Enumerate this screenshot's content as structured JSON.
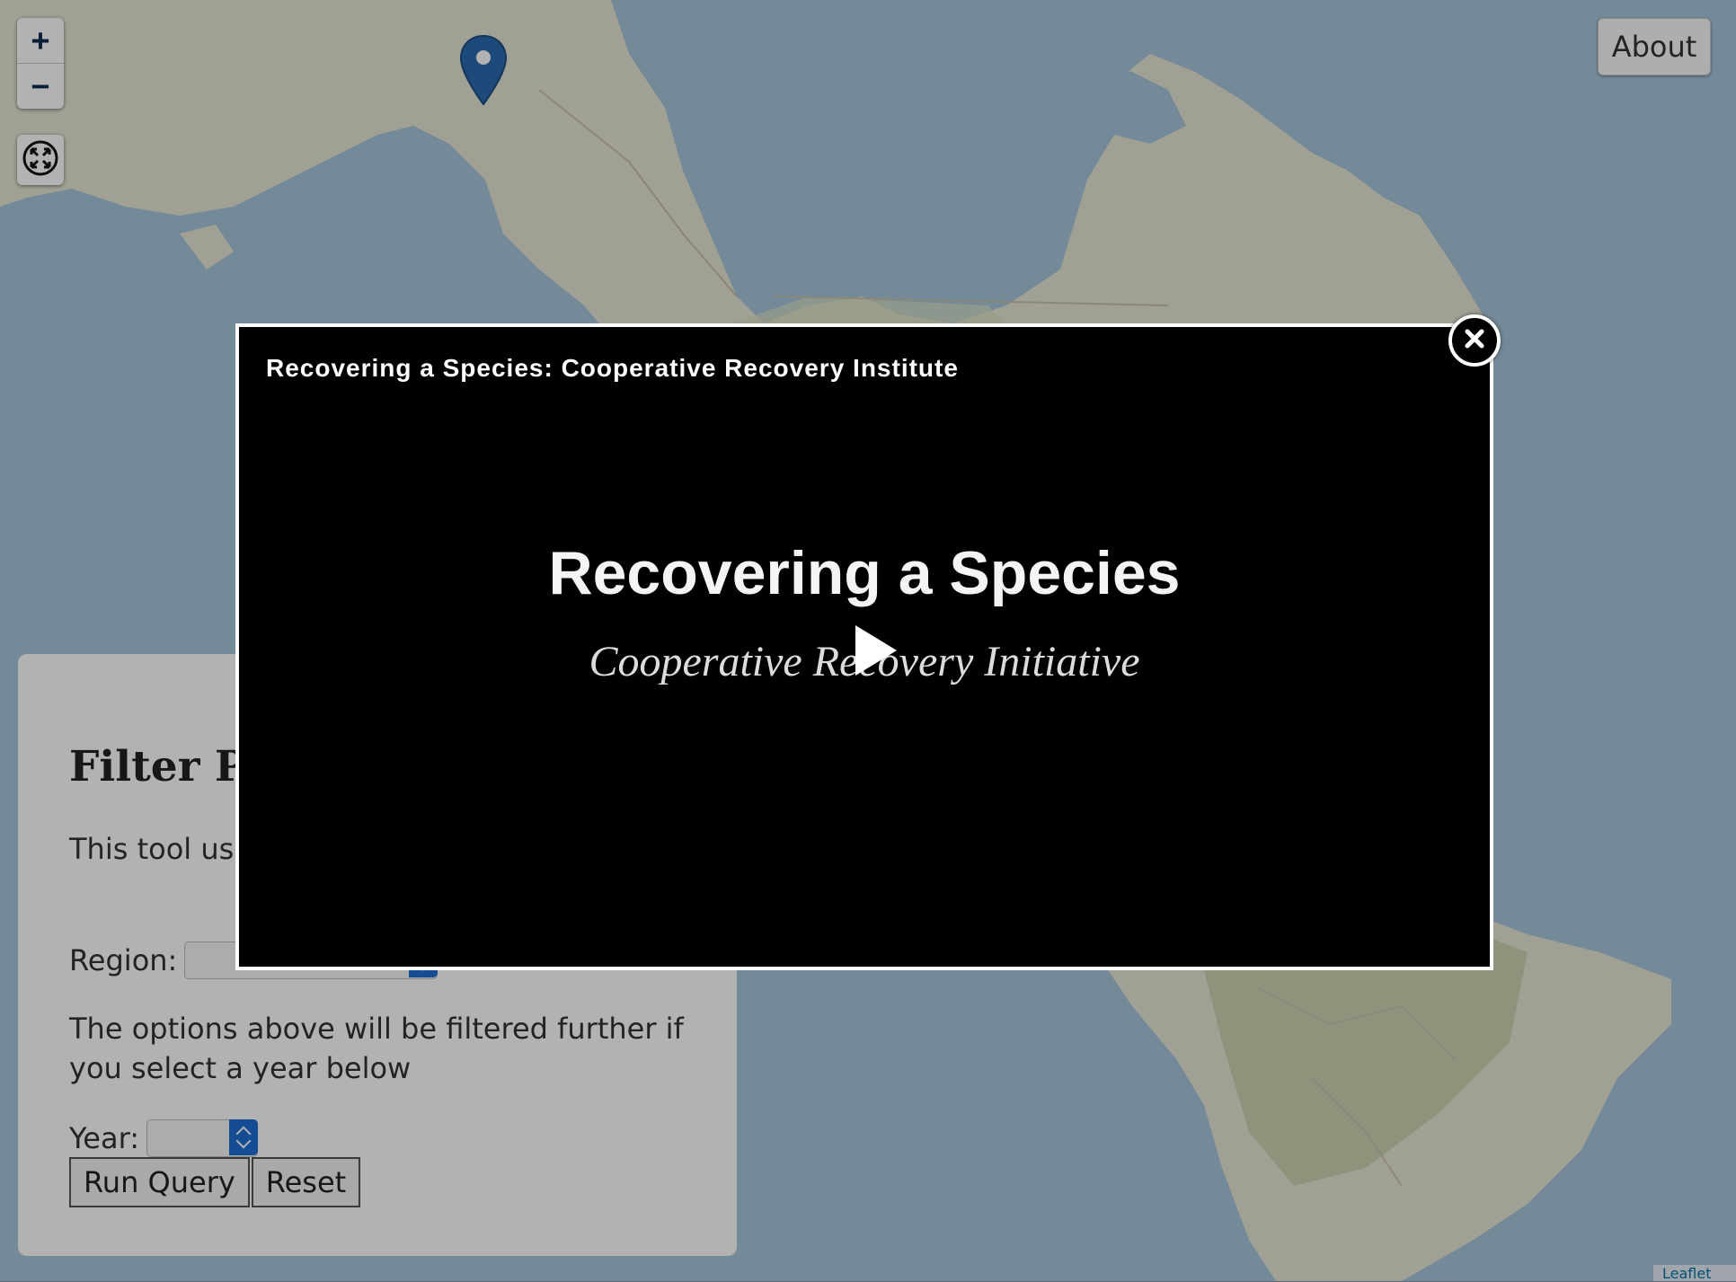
{
  "map": {
    "zoom_in": "+",
    "zoom_out": "−",
    "attribution": "Leaflet",
    "colors": {
      "ocean": "#a7c6dc",
      "land": "#e7e6d4",
      "vegetation": "#c9d3ad",
      "marker": "#2a6bb0"
    }
  },
  "about_button": {
    "label": "About"
  },
  "filter_panel": {
    "title": "Filter Pr",
    "intro_text": "This tool use below into a",
    "region_label": "Region:",
    "filter_note": "The options above will be filtered further if you select a year below",
    "year_label": "Year:",
    "run_query_label": "Run Query",
    "reset_label": "Reset"
  },
  "modal": {
    "title": "Recovering a Species: Cooperative Recovery Institute",
    "video_title": "Recovering a Species",
    "video_subtitle": "Cooperative Recovery Initiative"
  }
}
